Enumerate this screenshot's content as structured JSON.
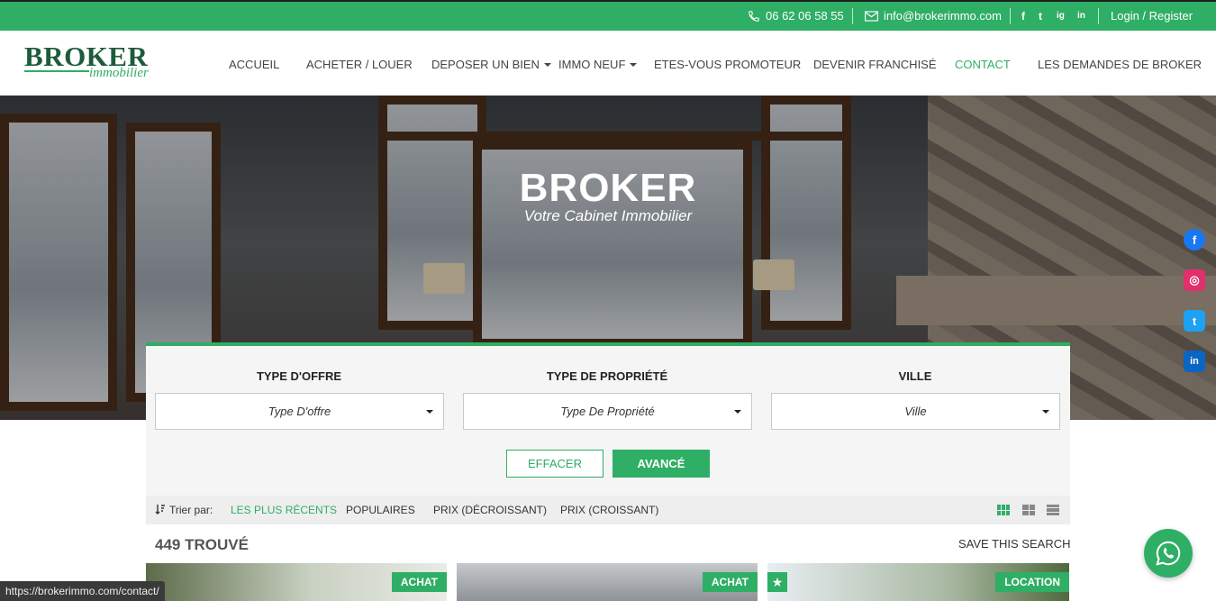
{
  "topbar": {
    "phone": "06 62 06 58 55",
    "email": "info@brokerimmo.com",
    "social": [
      "f",
      "t",
      "ig",
      "in"
    ],
    "login": "Login / Register"
  },
  "logo": {
    "main": "BROKER",
    "sub": "immobilier"
  },
  "nav": {
    "items": [
      {
        "label": "ACCUEIL"
      },
      {
        "label": "ACHETER / LOUER"
      },
      {
        "label": "DEPOSER UN BIEN"
      },
      {
        "label": "IMMO NEUF"
      },
      {
        "label": "ETES-VOUS PROMOTEUR"
      },
      {
        "label": "DEVENIR FRANCHISÉ"
      },
      {
        "label": "CONTACT"
      },
      {
        "label": "LES DEMANDES DE BROKER"
      }
    ]
  },
  "hero": {
    "title": "BROKER",
    "subtitle": "Votre Cabinet Immobilier"
  },
  "side_social": [
    {
      "name": "facebook",
      "glyph": "f",
      "color": "#1877f2"
    },
    {
      "name": "instagram",
      "glyph": "◎",
      "color": "#e1306c"
    },
    {
      "name": "twitter",
      "glyph": "t",
      "color": "#1da1f2"
    },
    {
      "name": "linkedin",
      "glyph": "in",
      "color": "#0a66c2"
    }
  ],
  "search": {
    "fields": [
      {
        "label": "TYPE D'OFFRE",
        "value": "Type D'offre"
      },
      {
        "label": "TYPE DE PROPRIÉTÉ",
        "value": "Type De Propriété"
      },
      {
        "label": "VILLE",
        "value": "Ville"
      }
    ],
    "clear_label": "EFFACER",
    "advanced_label": "AVANCÉ"
  },
  "sort": {
    "prefix": "Trier par:",
    "options": [
      {
        "label": "LES PLUS RÉCENTS"
      },
      {
        "label": "POPULAIRES"
      },
      {
        "label": "PRIX (DÉCROISSANT)"
      },
      {
        "label": "PRIX (CROISSANT)"
      }
    ],
    "active_index": 0
  },
  "results": {
    "count": "449 TROUVÉ",
    "save_label": "SAVE THIS SEARCH"
  },
  "cards": [
    {
      "badge": "ACHAT",
      "featured": false
    },
    {
      "badge": "ACHAT",
      "featured": false
    },
    {
      "badge": "LOCATION",
      "featured": true
    }
  ],
  "statusbar": {
    "url": "https://brokerimmo.com/contact/"
  },
  "colors": {
    "accent": "#2fae66",
    "logo_dark": "#1d5c3a"
  }
}
